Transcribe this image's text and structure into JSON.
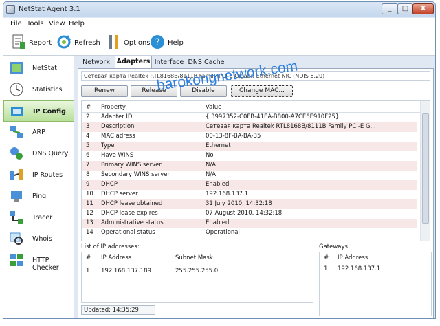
{
  "window": {
    "title": "NetStat Agent 3.1",
    "minimize": "_",
    "maximize": "□",
    "close": "X"
  },
  "menu": [
    "File",
    "Tools",
    "View",
    "Help"
  ],
  "toolbar": {
    "report": "Report",
    "refresh": "Refresh",
    "options": "Options",
    "help": "Help"
  },
  "sidebar": [
    "NetStat",
    "Statistics",
    "IP Config",
    "ARP",
    "DNS Query",
    "IP Routes",
    "Ping",
    "Tracer",
    "Whois",
    "HTTP Checker"
  ],
  "tabs": [
    "Network",
    "Adapters",
    "Interface",
    "DNS Cache"
  ],
  "adapter_select": "Сетевая карта Realtek RTL8168B/8111B Family PCI-E Gigabit Ethernet NIC (NDIS 6.20)",
  "buttons": {
    "renew": "Renew",
    "release": "Release",
    "disable": "Disable",
    "change_mac": "Change MAC..."
  },
  "grid": {
    "headers": [
      "#",
      "Property",
      "Value"
    ],
    "rows": [
      [
        "2",
        "Adapter ID",
        "{.3997352-C0FB-41EA-B800-A7CE6E910F25}"
      ],
      [
        "3",
        "Description",
        "Сетевая карта Realtek RTL8168B/8111B Family PCI-E G..."
      ],
      [
        "4",
        "MAC adress",
        "00-13-8F-BA-BA-35"
      ],
      [
        "5",
        "Type",
        "Ethernet"
      ],
      [
        "6",
        "Have WINS",
        "No"
      ],
      [
        "7",
        "Primary WINS server",
        "N/A"
      ],
      [
        "8",
        "Secondary WINS server",
        "N/A"
      ],
      [
        "9",
        "DHCP",
        "Enabled"
      ],
      [
        "10",
        "DHCP server",
        "192.168.137.1"
      ],
      [
        "11",
        "DHCP lease obtained",
        "31 July 2010, 14:32:18"
      ],
      [
        "12",
        "DHCP lease expires",
        "07 August 2010, 14:32:18"
      ],
      [
        "13",
        "Administrative status",
        "Enabled"
      ],
      [
        "14",
        "Operational status",
        "Operational"
      ]
    ]
  },
  "ip_list": {
    "label": "List of IP addresses:",
    "headers": [
      "#",
      "IP Address",
      "Subnet Mask"
    ],
    "rows": [
      [
        "1",
        "192.168.137.189",
        "255.255.255.0"
      ]
    ]
  },
  "gateways": {
    "label": "Gateways:",
    "headers": [
      "#",
      "IP Address"
    ],
    "rows": [
      [
        "1",
        "192.168.137.1"
      ]
    ]
  },
  "status": "Updated: 14:35:29",
  "watermark": "barokongnetwork.com",
  "colors": {
    "accent": "#2d7fe0",
    "active_nav": "#b8e099",
    "alt_row": "#f7e7e7"
  }
}
